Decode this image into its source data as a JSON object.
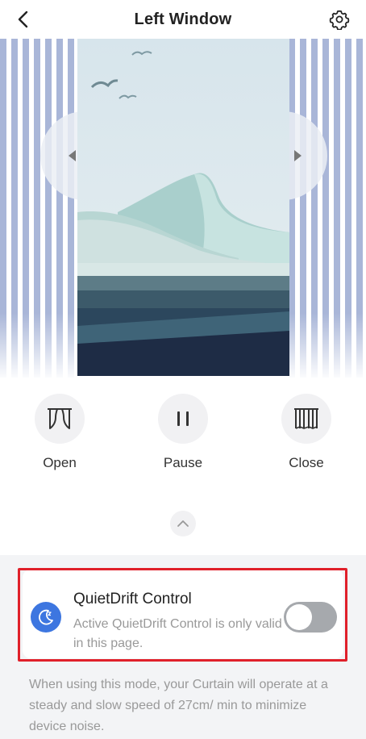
{
  "header": {
    "title": "Left Window",
    "back_icon": "chevron-left-icon",
    "settings_icon": "gear-icon"
  },
  "curtain": {
    "prev_icon": "triangle-left-icon",
    "next_icon": "triangle-right-icon",
    "colors": {
      "stripe": "#a9b6d8",
      "sky": "#dde8ee",
      "sea_dark": "#1e2c45"
    }
  },
  "controls": {
    "open": {
      "label": "Open",
      "icon": "curtain-open-icon"
    },
    "pause": {
      "label": "Pause",
      "icon": "pause-icon"
    },
    "close": {
      "label": "Close",
      "icon": "curtain-closed-icon"
    },
    "collapse_icon": "chevron-up-icon"
  },
  "quiet_mode": {
    "icon": "moon-sleep-icon",
    "title": "QuietDrift Control",
    "description": "Active QuietDrift Control is only valid in this page.",
    "enabled": false,
    "footnote": "When using this mode, your Curtain will operate at a steady and slow speed of 27cm/ min to minimize device noise.",
    "colors": {
      "accent": "#3d76e0",
      "highlight_border": "#e0202a",
      "toggle_off": "#a6a9ad"
    }
  }
}
